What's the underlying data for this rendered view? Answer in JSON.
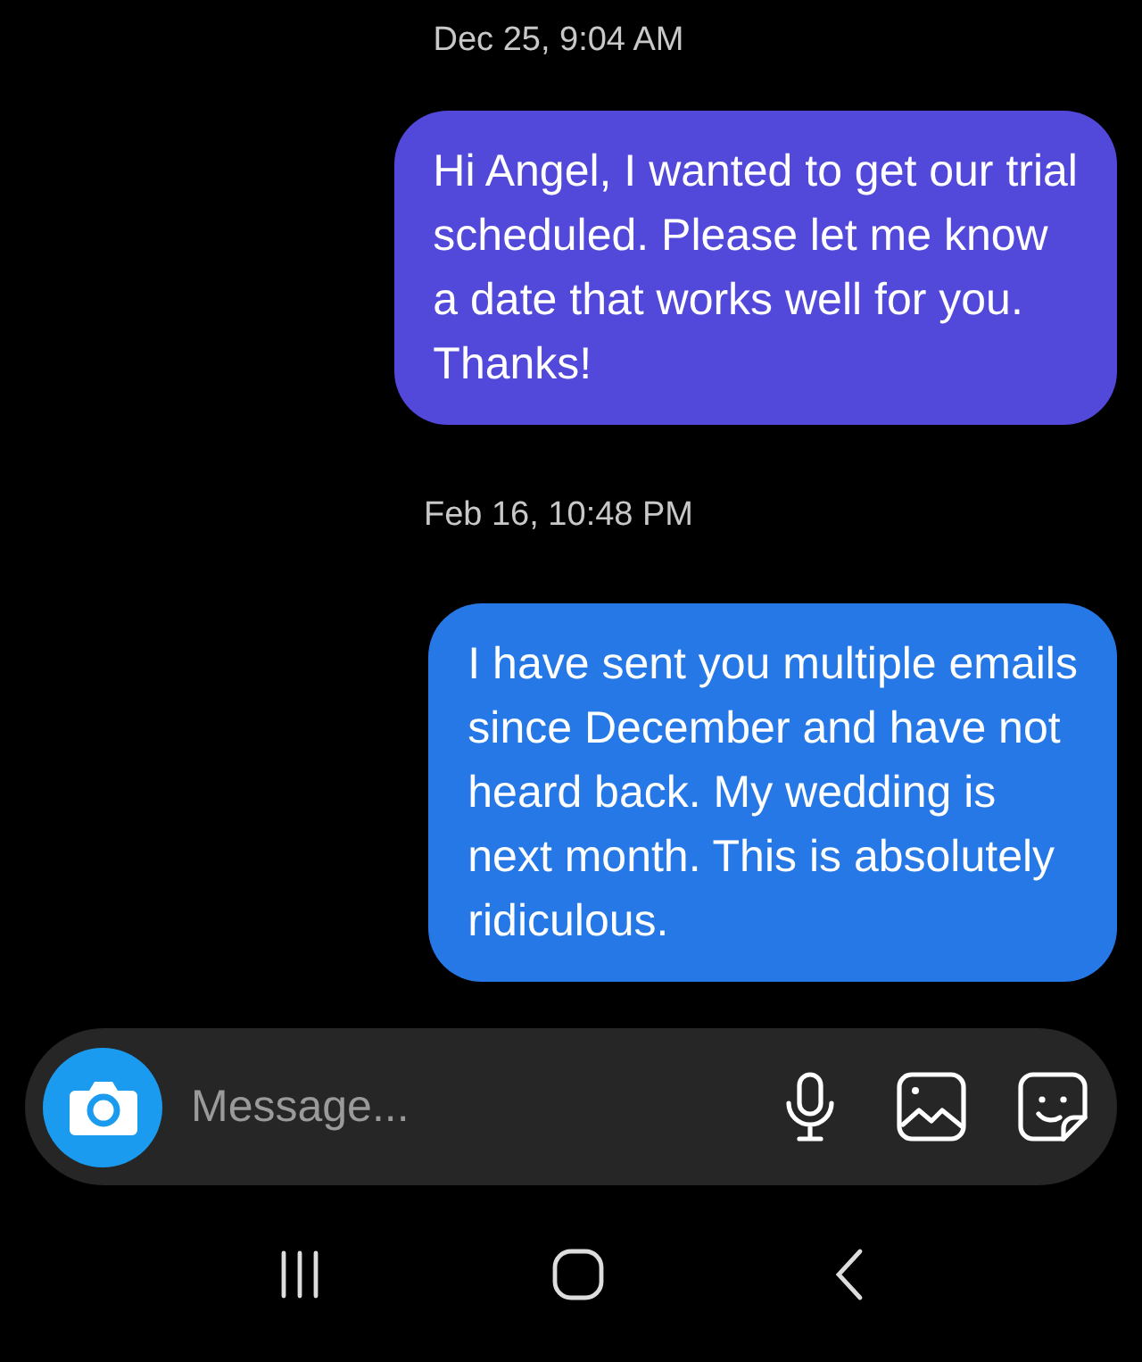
{
  "thread": [
    {
      "kind": "timestamp",
      "text": "Dec 25, 9:04 AM"
    },
    {
      "kind": "message",
      "text": "Hi Angel, I wanted to get our trial\nscheduled. Please let me know\na date that works well for you.\nThanks!",
      "color": "#5248d9"
    },
    {
      "kind": "timestamp",
      "text": "Feb 16, 10:48 PM"
    },
    {
      "kind": "message",
      "text": "I have sent you multiple emails\nsince December and have not\nheard back. My wedding is\nnext month. This is absolutely\nridiculous.",
      "color": "#2678e6"
    }
  ],
  "composer": {
    "placeholder": "Message..."
  }
}
